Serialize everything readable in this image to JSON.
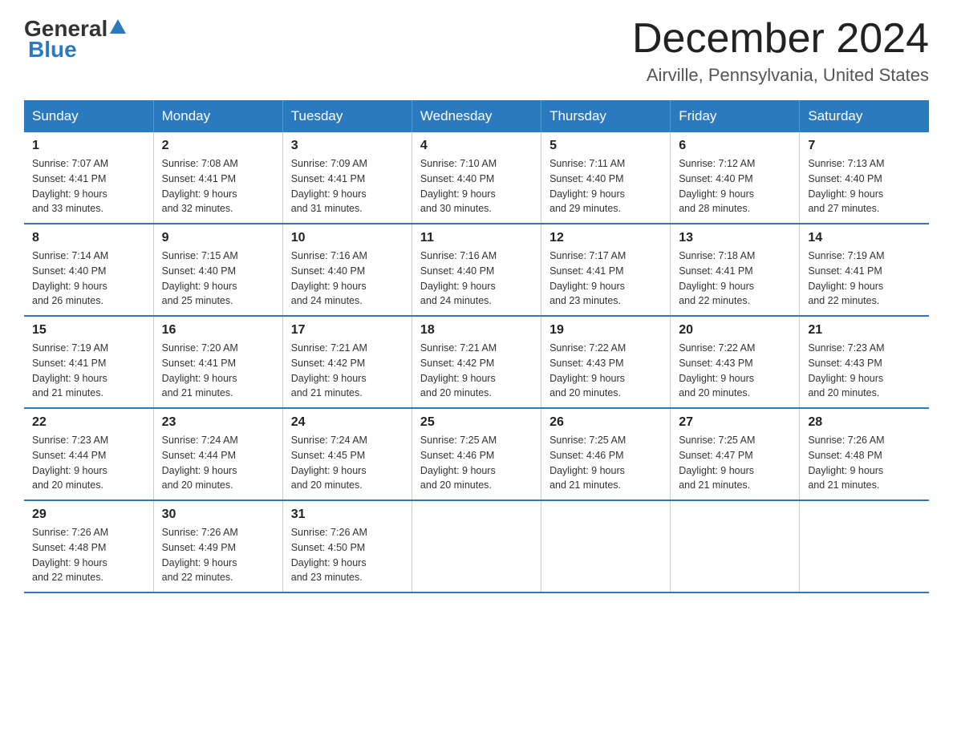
{
  "header": {
    "logo_general": "General",
    "logo_blue": "Blue",
    "title": "December 2024",
    "location": "Airville, Pennsylvania, United States"
  },
  "days_of_week": [
    "Sunday",
    "Monday",
    "Tuesday",
    "Wednesday",
    "Thursday",
    "Friday",
    "Saturday"
  ],
  "weeks": [
    [
      {
        "day": "1",
        "sunrise": "7:07 AM",
        "sunset": "4:41 PM",
        "daylight": "9 hours and 33 minutes."
      },
      {
        "day": "2",
        "sunrise": "7:08 AM",
        "sunset": "4:41 PM",
        "daylight": "9 hours and 32 minutes."
      },
      {
        "day": "3",
        "sunrise": "7:09 AM",
        "sunset": "4:41 PM",
        "daylight": "9 hours and 31 minutes."
      },
      {
        "day": "4",
        "sunrise": "7:10 AM",
        "sunset": "4:40 PM",
        "daylight": "9 hours and 30 minutes."
      },
      {
        "day": "5",
        "sunrise": "7:11 AM",
        "sunset": "4:40 PM",
        "daylight": "9 hours and 29 minutes."
      },
      {
        "day": "6",
        "sunrise": "7:12 AM",
        "sunset": "4:40 PM",
        "daylight": "9 hours and 28 minutes."
      },
      {
        "day": "7",
        "sunrise": "7:13 AM",
        "sunset": "4:40 PM",
        "daylight": "9 hours and 27 minutes."
      }
    ],
    [
      {
        "day": "8",
        "sunrise": "7:14 AM",
        "sunset": "4:40 PM",
        "daylight": "9 hours and 26 minutes."
      },
      {
        "day": "9",
        "sunrise": "7:15 AM",
        "sunset": "4:40 PM",
        "daylight": "9 hours and 25 minutes."
      },
      {
        "day": "10",
        "sunrise": "7:16 AM",
        "sunset": "4:40 PM",
        "daylight": "9 hours and 24 minutes."
      },
      {
        "day": "11",
        "sunrise": "7:16 AM",
        "sunset": "4:40 PM",
        "daylight": "9 hours and 24 minutes."
      },
      {
        "day": "12",
        "sunrise": "7:17 AM",
        "sunset": "4:41 PM",
        "daylight": "9 hours and 23 minutes."
      },
      {
        "day": "13",
        "sunrise": "7:18 AM",
        "sunset": "4:41 PM",
        "daylight": "9 hours and 22 minutes."
      },
      {
        "day": "14",
        "sunrise": "7:19 AM",
        "sunset": "4:41 PM",
        "daylight": "9 hours and 22 minutes."
      }
    ],
    [
      {
        "day": "15",
        "sunrise": "7:19 AM",
        "sunset": "4:41 PM",
        "daylight": "9 hours and 21 minutes."
      },
      {
        "day": "16",
        "sunrise": "7:20 AM",
        "sunset": "4:41 PM",
        "daylight": "9 hours and 21 minutes."
      },
      {
        "day": "17",
        "sunrise": "7:21 AM",
        "sunset": "4:42 PM",
        "daylight": "9 hours and 21 minutes."
      },
      {
        "day": "18",
        "sunrise": "7:21 AM",
        "sunset": "4:42 PM",
        "daylight": "9 hours and 20 minutes."
      },
      {
        "day": "19",
        "sunrise": "7:22 AM",
        "sunset": "4:43 PM",
        "daylight": "9 hours and 20 minutes."
      },
      {
        "day": "20",
        "sunrise": "7:22 AM",
        "sunset": "4:43 PM",
        "daylight": "9 hours and 20 minutes."
      },
      {
        "day": "21",
        "sunrise": "7:23 AM",
        "sunset": "4:43 PM",
        "daylight": "9 hours and 20 minutes."
      }
    ],
    [
      {
        "day": "22",
        "sunrise": "7:23 AM",
        "sunset": "4:44 PM",
        "daylight": "9 hours and 20 minutes."
      },
      {
        "day": "23",
        "sunrise": "7:24 AM",
        "sunset": "4:44 PM",
        "daylight": "9 hours and 20 minutes."
      },
      {
        "day": "24",
        "sunrise": "7:24 AM",
        "sunset": "4:45 PM",
        "daylight": "9 hours and 20 minutes."
      },
      {
        "day": "25",
        "sunrise": "7:25 AM",
        "sunset": "4:46 PM",
        "daylight": "9 hours and 20 minutes."
      },
      {
        "day": "26",
        "sunrise": "7:25 AM",
        "sunset": "4:46 PM",
        "daylight": "9 hours and 21 minutes."
      },
      {
        "day": "27",
        "sunrise": "7:25 AM",
        "sunset": "4:47 PM",
        "daylight": "9 hours and 21 minutes."
      },
      {
        "day": "28",
        "sunrise": "7:26 AM",
        "sunset": "4:48 PM",
        "daylight": "9 hours and 21 minutes."
      }
    ],
    [
      {
        "day": "29",
        "sunrise": "7:26 AM",
        "sunset": "4:48 PM",
        "daylight": "9 hours and 22 minutes."
      },
      {
        "day": "30",
        "sunrise": "7:26 AM",
        "sunset": "4:49 PM",
        "daylight": "9 hours and 22 minutes."
      },
      {
        "day": "31",
        "sunrise": "7:26 AM",
        "sunset": "4:50 PM",
        "daylight": "9 hours and 23 minutes."
      },
      null,
      null,
      null,
      null
    ]
  ],
  "labels": {
    "sunrise": "Sunrise:",
    "sunset": "Sunset:",
    "daylight": "Daylight:"
  }
}
